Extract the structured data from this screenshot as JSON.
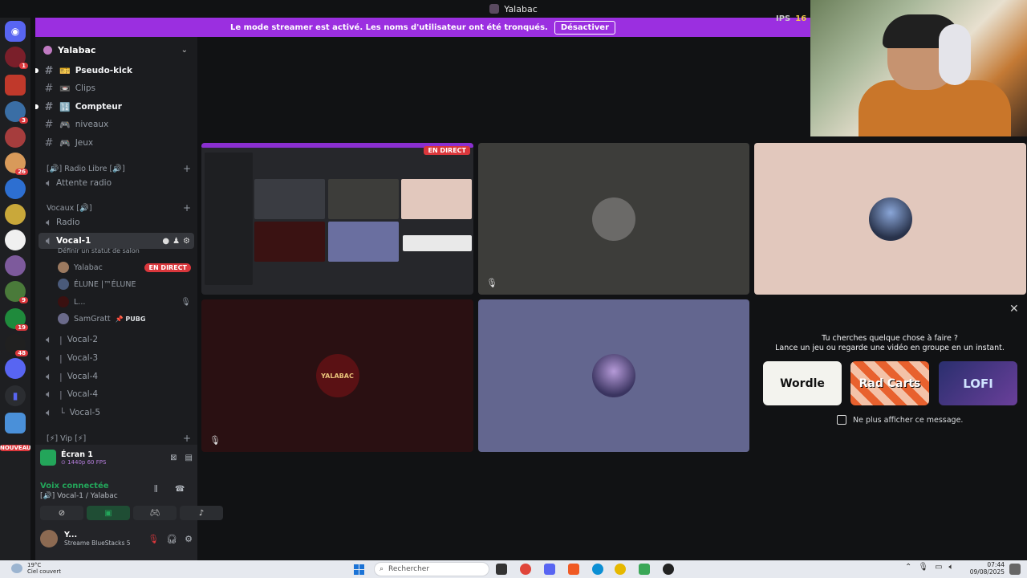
{
  "window": {
    "title": "Yalabac"
  },
  "banner": {
    "text": "Le mode streamer est activé. Les noms d'utilisateur ont été tronqués.",
    "button": "Désactiver"
  },
  "fps": {
    "label": "IPS",
    "value": "16"
  },
  "server_rail": {
    "nouveau": "NOUVEAU",
    "badges": [
      "1",
      "3",
      "26",
      "9",
      "19",
      "48"
    ]
  },
  "guild": {
    "name": "Yalabac"
  },
  "channels": {
    "text": [
      {
        "name": "Pseudo-kick",
        "emoji": "🎫"
      },
      {
        "name": "Clips",
        "emoji": "📼"
      },
      {
        "name": "Compteur",
        "emoji": "🔢"
      },
      {
        "name": "niveaux",
        "emoji": "🎮"
      },
      {
        "name": "Jeux",
        "emoji": "🎮"
      }
    ],
    "cat_radio": "[🔊] Radio Libre [🔊]",
    "radio_wait": "Attente radio",
    "cat_vocaux": "Vocaux [🔊]",
    "radio": "Radio",
    "vocal1": "Vocal-1",
    "status_placeholder": "Définir un statut de salon",
    "users": [
      {
        "name": "Yalabac",
        "badge": "EN DIRECT"
      },
      {
        "name": "ÉLUNE |™ÉLUNE"
      },
      {
        "name": "L..."
      },
      {
        "name": "SamGratt",
        "game": "📌 PUBG"
      }
    ],
    "vocal_others": [
      "Vocal-2",
      "Vocal-3",
      "Vocal-4",
      "Vocal-4",
      "Vocal-5"
    ],
    "cat_vip": "[⚡] Vip [⚡]"
  },
  "screen_share": {
    "title": "Écran 1",
    "sub": "⊙ 1440p 60 FPS"
  },
  "voice": {
    "status": "Voix connectée",
    "channel": "[🔊] Vocal-1 / Yalabac"
  },
  "me": {
    "name": "Y...",
    "status": "Streame BlueStacks 5"
  },
  "stage": {
    "live_badge": "EN DIRECT",
    "yalabac_logo": "YALABAC"
  },
  "activity": {
    "title_line1": "Tu cherches quelque chose à faire ?",
    "title_line2": "Lance un jeu ou regarde une vidéo en groupe en un instant.",
    "cards": [
      "Wordle",
      "Rad Carts",
      "LOFI"
    ],
    "checkbox_label": "Ne plus afficher ce message."
  },
  "taskbar": {
    "weather_temp": "19°C",
    "weather_desc": "Ciel couvert",
    "search": "Rechercher",
    "time": "07:44",
    "date": "09/08/2025"
  }
}
